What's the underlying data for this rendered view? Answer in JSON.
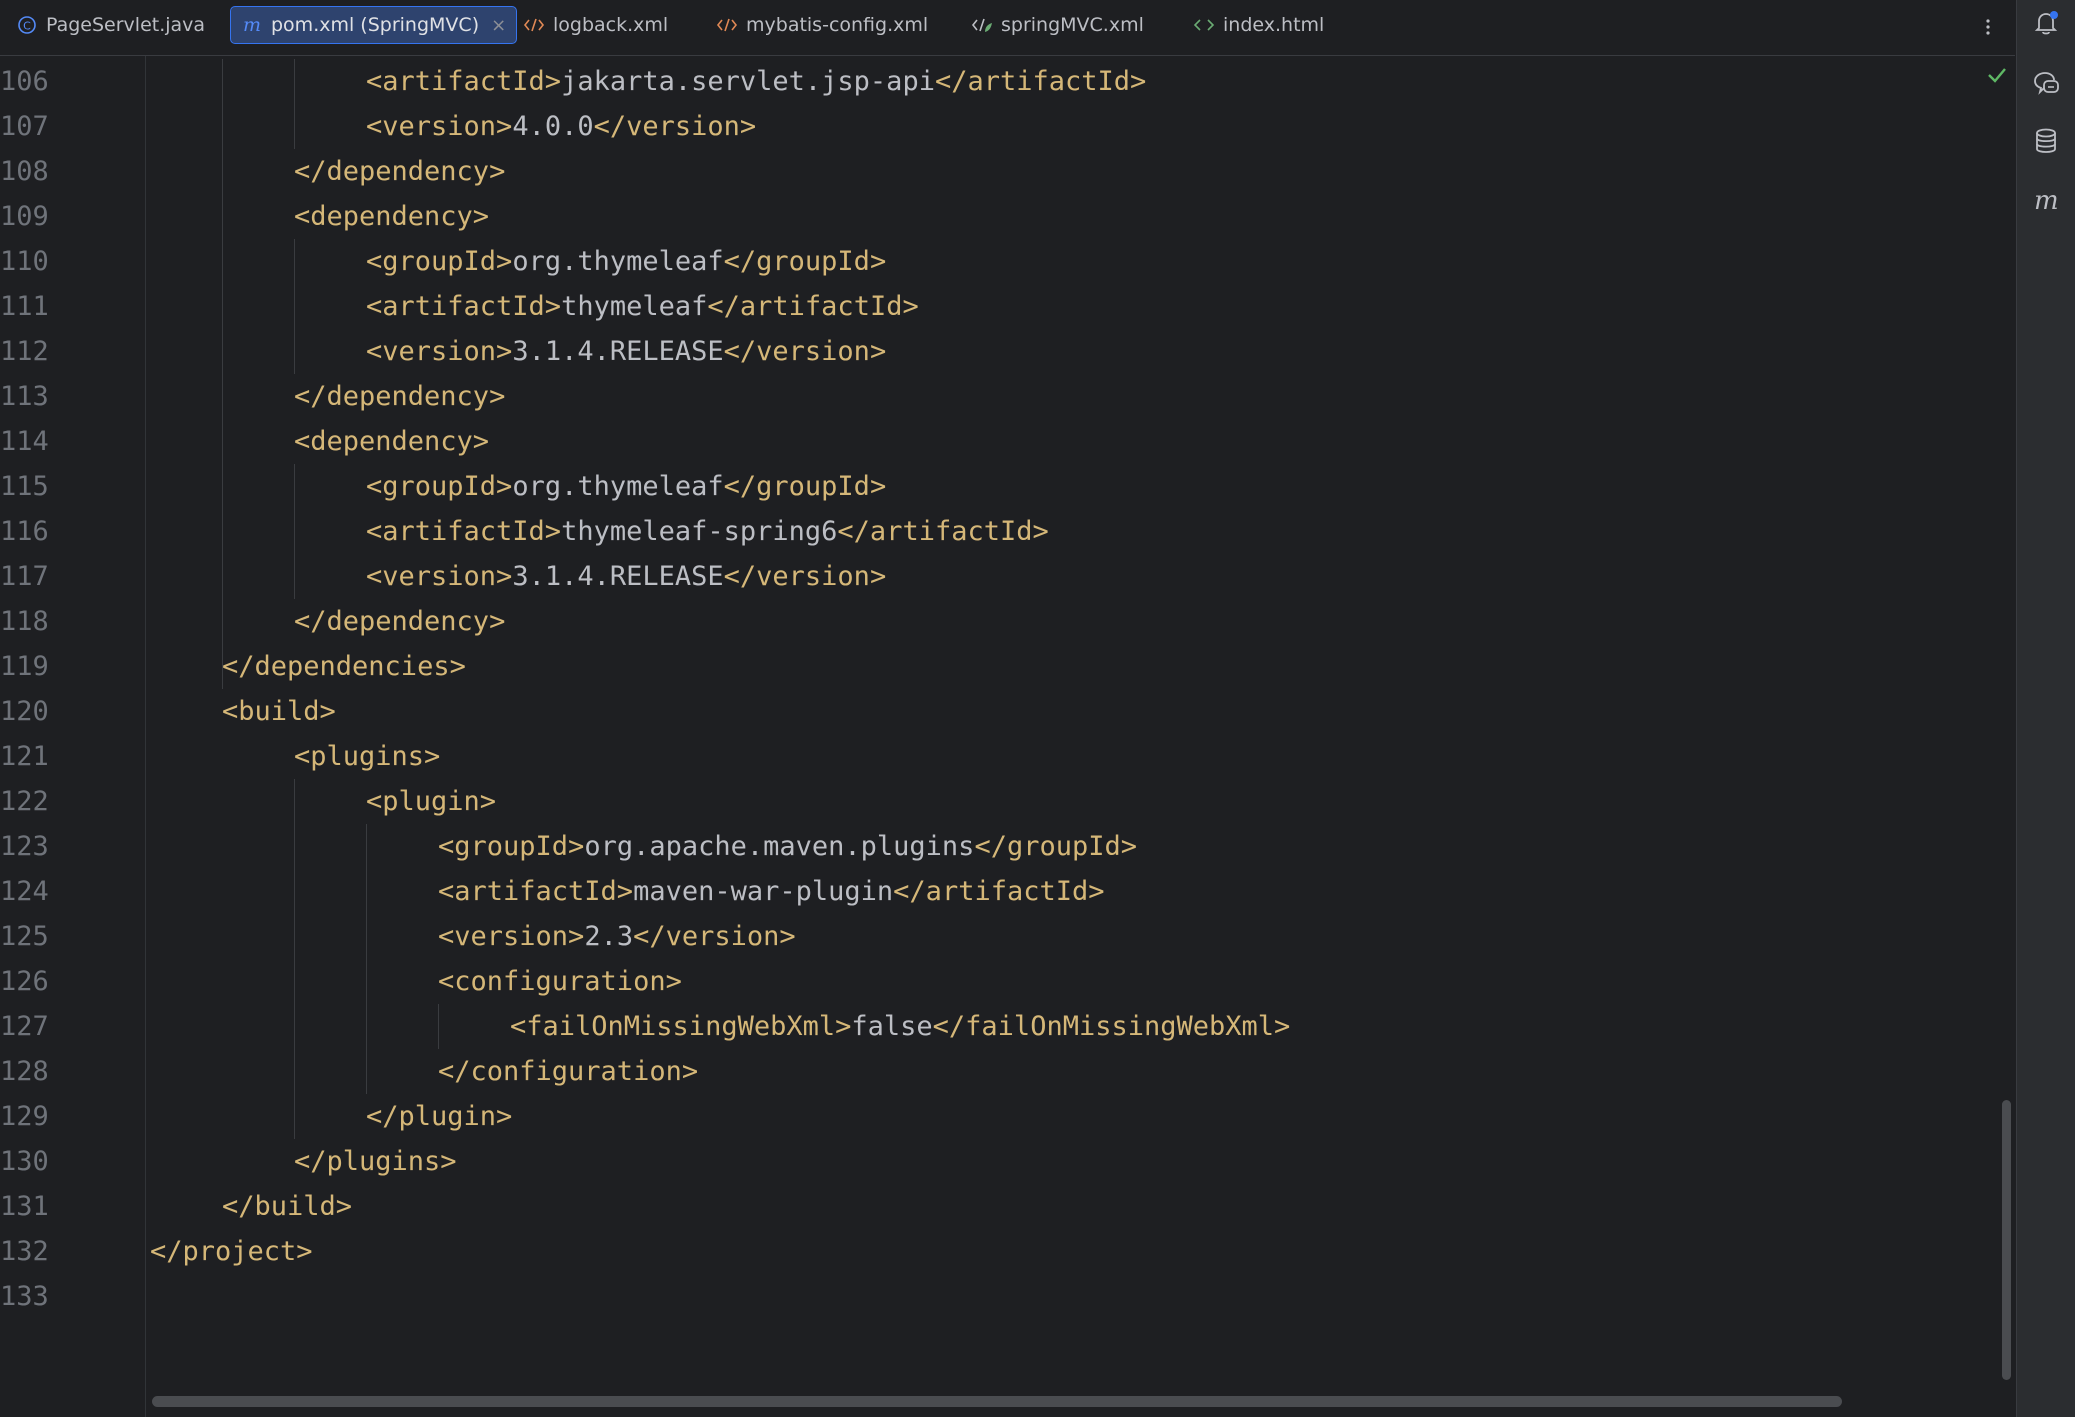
{
  "tabs": [
    {
      "label": "PageServlet.java",
      "icon": "java-class-icon",
      "color": "#548af7"
    },
    {
      "label": "pom.xml (SpringMVC)",
      "icon": "maven-icon",
      "color": "#548af7",
      "active": true
    },
    {
      "label": "logback.xml",
      "icon": "xml-icon",
      "color": "#e08855"
    },
    {
      "label": "mybatis-config.xml",
      "icon": "xml-icon",
      "color": "#e08855"
    },
    {
      "label": "springMVC.xml",
      "icon": "spring-xml-icon",
      "color": "#6aab73"
    },
    {
      "label": "index.html",
      "icon": "html-icon",
      "color": "#6aab73"
    }
  ],
  "active_tab_close": "×",
  "editor": {
    "inspection_status": "ok",
    "lines": [
      {
        "num": "106",
        "indent": 3,
        "tag_open": "<artifactId>",
        "text": "jakarta.servlet.jsp-api",
        "tag_close": "</artifactId>"
      },
      {
        "num": "107",
        "indent": 3,
        "tag_open": "<version>",
        "text": "4.0.0",
        "tag_close": "</version>"
      },
      {
        "num": "108",
        "indent": 2,
        "tag_open": "</dependency>",
        "text": "",
        "tag_close": ""
      },
      {
        "num": "109",
        "indent": 2,
        "tag_open": "<dependency>",
        "text": "",
        "tag_close": ""
      },
      {
        "num": "110",
        "indent": 3,
        "tag_open": "<groupId>",
        "text": "org.thymeleaf",
        "tag_close": "</groupId>"
      },
      {
        "num": "111",
        "indent": 3,
        "tag_open": "<artifactId>",
        "text": "thymeleaf",
        "tag_close": "</artifactId>"
      },
      {
        "num": "112",
        "indent": 3,
        "tag_open": "<version>",
        "text": "3.1.4.RELEASE",
        "tag_close": "</version>"
      },
      {
        "num": "113",
        "indent": 2,
        "tag_open": "</dependency>",
        "text": "",
        "tag_close": ""
      },
      {
        "num": "114",
        "indent": 2,
        "tag_open": "<dependency>",
        "text": "",
        "tag_close": ""
      },
      {
        "num": "115",
        "indent": 3,
        "tag_open": "<groupId>",
        "text": "org.thymeleaf",
        "tag_close": "</groupId>"
      },
      {
        "num": "116",
        "indent": 3,
        "tag_open": "<artifactId>",
        "text": "thymeleaf-spring6",
        "tag_close": "</artifactId>"
      },
      {
        "num": "117",
        "indent": 3,
        "tag_open": "<version>",
        "text": "3.1.4.RELEASE",
        "tag_close": "</version>"
      },
      {
        "num": "118",
        "indent": 2,
        "tag_open": "</dependency>",
        "text": "",
        "tag_close": ""
      },
      {
        "num": "119",
        "indent": 1,
        "tag_open": "</dependencies>",
        "text": "",
        "tag_close": ""
      },
      {
        "num": "120",
        "indent": 1,
        "tag_open": "<build>",
        "text": "",
        "tag_close": ""
      },
      {
        "num": "121",
        "indent": 2,
        "tag_open": "<plugins>",
        "text": "",
        "tag_close": ""
      },
      {
        "num": "122",
        "indent": 3,
        "tag_open": "<plugin>",
        "text": "",
        "tag_close": ""
      },
      {
        "num": "123",
        "indent": 4,
        "tag_open": "<groupId>",
        "text": "org.apache.maven.plugins",
        "tag_close": "</groupId>"
      },
      {
        "num": "124",
        "indent": 4,
        "tag_open": "<artifactId>",
        "text": "maven-war-plugin",
        "tag_close": "</artifactId>"
      },
      {
        "num": "125",
        "indent": 4,
        "tag_open": "<version>",
        "text": "2.3",
        "tag_close": "</version>"
      },
      {
        "num": "126",
        "indent": 4,
        "tag_open": "<configuration>",
        "text": "",
        "tag_close": ""
      },
      {
        "num": "127",
        "indent": 5,
        "tag_open": "<failOnMissingWebXml>",
        "text": "false",
        "tag_close": "</failOnMissingWebXml>"
      },
      {
        "num": "128",
        "indent": 4,
        "tag_open": "</configuration>",
        "text": "",
        "tag_close": ""
      },
      {
        "num": "129",
        "indent": 3,
        "tag_open": "</plugin>",
        "text": "",
        "tag_close": ""
      },
      {
        "num": "130",
        "indent": 2,
        "tag_open": "</plugins>",
        "text": "",
        "tag_close": ""
      },
      {
        "num": "131",
        "indent": 1,
        "tag_open": "</build>",
        "text": "",
        "tag_close": ""
      },
      {
        "num": "132",
        "indent": 0,
        "tag_open": "</project>",
        "text": "",
        "tag_close": ""
      },
      {
        "num": "133",
        "indent": 0,
        "tag_open": "",
        "text": "",
        "tag_close": ""
      }
    ]
  },
  "tool_strip": [
    {
      "name": "notifications-icon"
    },
    {
      "name": "ai-assistant-icon"
    },
    {
      "name": "database-icon"
    },
    {
      "name": "maven-icon"
    }
  ],
  "colors": {
    "background": "#1e1f22",
    "tag": "#d5b778",
    "text": "#bcbec4",
    "line_number": "#6f737a",
    "accent": "#3574f0",
    "check": "#5fb865"
  }
}
